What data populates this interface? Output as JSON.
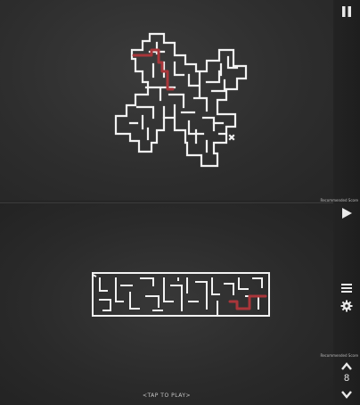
{
  "game": {
    "tap_to_play": "<TAP TO PLAY>",
    "level_number": "8",
    "side_caption_top": "Recommended Score",
    "side_caption_bottom": "Recommended Score"
  },
  "controls": {
    "pause_icon": "pause-icon",
    "play_icon": "play-icon",
    "menu_icon": "menu-icon",
    "settings_icon": "gear-icon",
    "level_up_icon": "chevron-up-icon",
    "level_down_icon": "chevron-down-icon"
  },
  "colors": {
    "wall": "#f2f2f2",
    "trail": "#a9363a",
    "board": "#2e2e2e"
  }
}
